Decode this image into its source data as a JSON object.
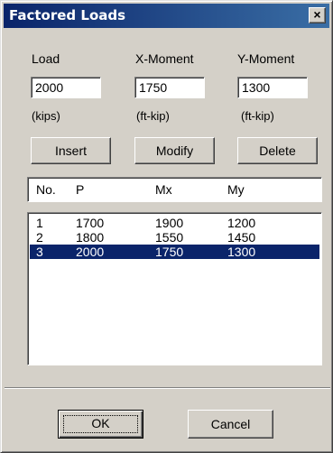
{
  "window": {
    "title": "Factored Loads",
    "close_symbol": "×"
  },
  "inputs": {
    "load": {
      "label": "Load",
      "value": "2000",
      "unit": "(kips)"
    },
    "x_moment": {
      "label": "X-Moment",
      "value": "1750",
      "unit": "(ft-kip)"
    },
    "y_moment": {
      "label": "Y-Moment",
      "value": "1300",
      "unit": "(ft-kip)"
    }
  },
  "buttons": {
    "insert": "Insert",
    "modify": "Modify",
    "delete": "Delete",
    "ok": "OK",
    "cancel": "Cancel"
  },
  "table": {
    "columns": [
      "No.",
      "P",
      "Mx",
      "My"
    ],
    "rows": [
      [
        "1",
        "1700",
        "1900",
        "1200"
      ],
      [
        "2",
        "1800",
        "1550",
        "1450"
      ],
      [
        "3",
        "2000",
        "1750",
        "1300"
      ]
    ],
    "selected_row": 3
  },
  "colors": {
    "selection": "#0a246a",
    "title_bar": "#0a246a",
    "dialog_face": "#d4d0c8"
  }
}
